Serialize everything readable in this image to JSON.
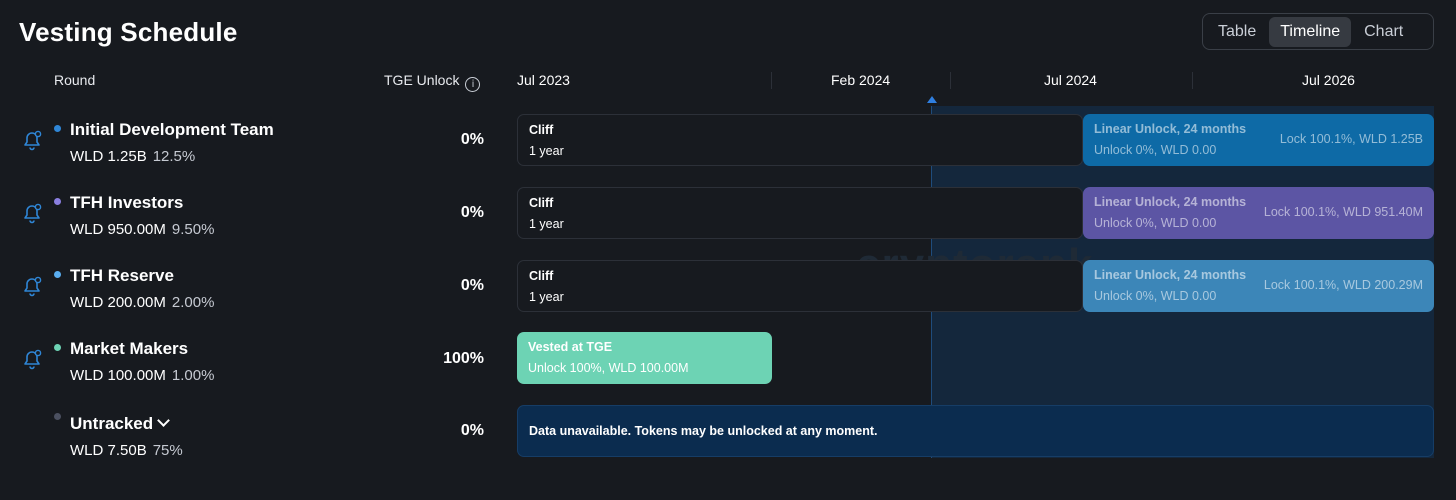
{
  "title": "Vesting Schedule",
  "view_toggle": {
    "options": [
      "Table",
      "Timeline",
      "Chart"
    ],
    "active": "Timeline"
  },
  "headers": {
    "round": "Round",
    "tge_unlock": "TGE Unlock",
    "info": "i"
  },
  "timeline_dates": [
    "Jul 2023",
    "Feb 2024",
    "Jul 2024",
    "Jul 2026"
  ],
  "watermark": "cryptorank",
  "colors": {
    "bg": "#171a1f",
    "team": "#0e6aa6",
    "investors": "#5c55a4",
    "reserve": "#3c86b8",
    "market_makers": "#6dd3b4",
    "untracked": "#0b2c4f",
    "today": "#2f7fe0"
  },
  "rows": [
    {
      "name": "Initial Development Team",
      "amount": "WLD 1.25B",
      "percent": "12.5%",
      "tge": "0%",
      "dot": "#2f86d6",
      "bell": true,
      "cliff": {
        "label": "Cliff",
        "duration": "1 year"
      },
      "linear": {
        "label": "Linear Unlock, 24 months",
        "detail": "Unlock 0%, WLD 0.00",
        "lock": "Lock 100.1%, WLD 1.25B"
      }
    },
    {
      "name": "TFH Investors",
      "amount": "WLD 950.00M",
      "percent": "9.50%",
      "tge": "0%",
      "dot": "#8a7fe0",
      "bell": true,
      "cliff": {
        "label": "Cliff",
        "duration": "1 year"
      },
      "linear": {
        "label": "Linear Unlock, 24 months",
        "detail": "Unlock 0%, WLD 0.00",
        "lock": "Lock 100.1%, WLD 951.40M"
      }
    },
    {
      "name": "TFH Reserve",
      "amount": "WLD 200.00M",
      "percent": "2.00%",
      "tge": "0%",
      "dot": "#5aaef0",
      "bell": true,
      "cliff": {
        "label": "Cliff",
        "duration": "1 year"
      },
      "linear": {
        "label": "Linear Unlock, 24 months",
        "detail": "Unlock 0%, WLD 0.00",
        "lock": "Lock 100.1%, WLD 200.29M"
      }
    },
    {
      "name": "Market Makers",
      "amount": "WLD 100.00M",
      "percent": "1.00%",
      "tge": "100%",
      "dot": "#6dd3b4",
      "bell": true,
      "vested": {
        "label": "Vested at TGE",
        "detail": "Unlock 100%, WLD 100.00M"
      }
    },
    {
      "name": "Untracked",
      "amount": "WLD 7.50B",
      "percent": "75%",
      "tge": "0%",
      "dot": "#4b5060",
      "bell": false,
      "note": "Data unavailable. Tokens may be unlocked at any moment."
    }
  ]
}
